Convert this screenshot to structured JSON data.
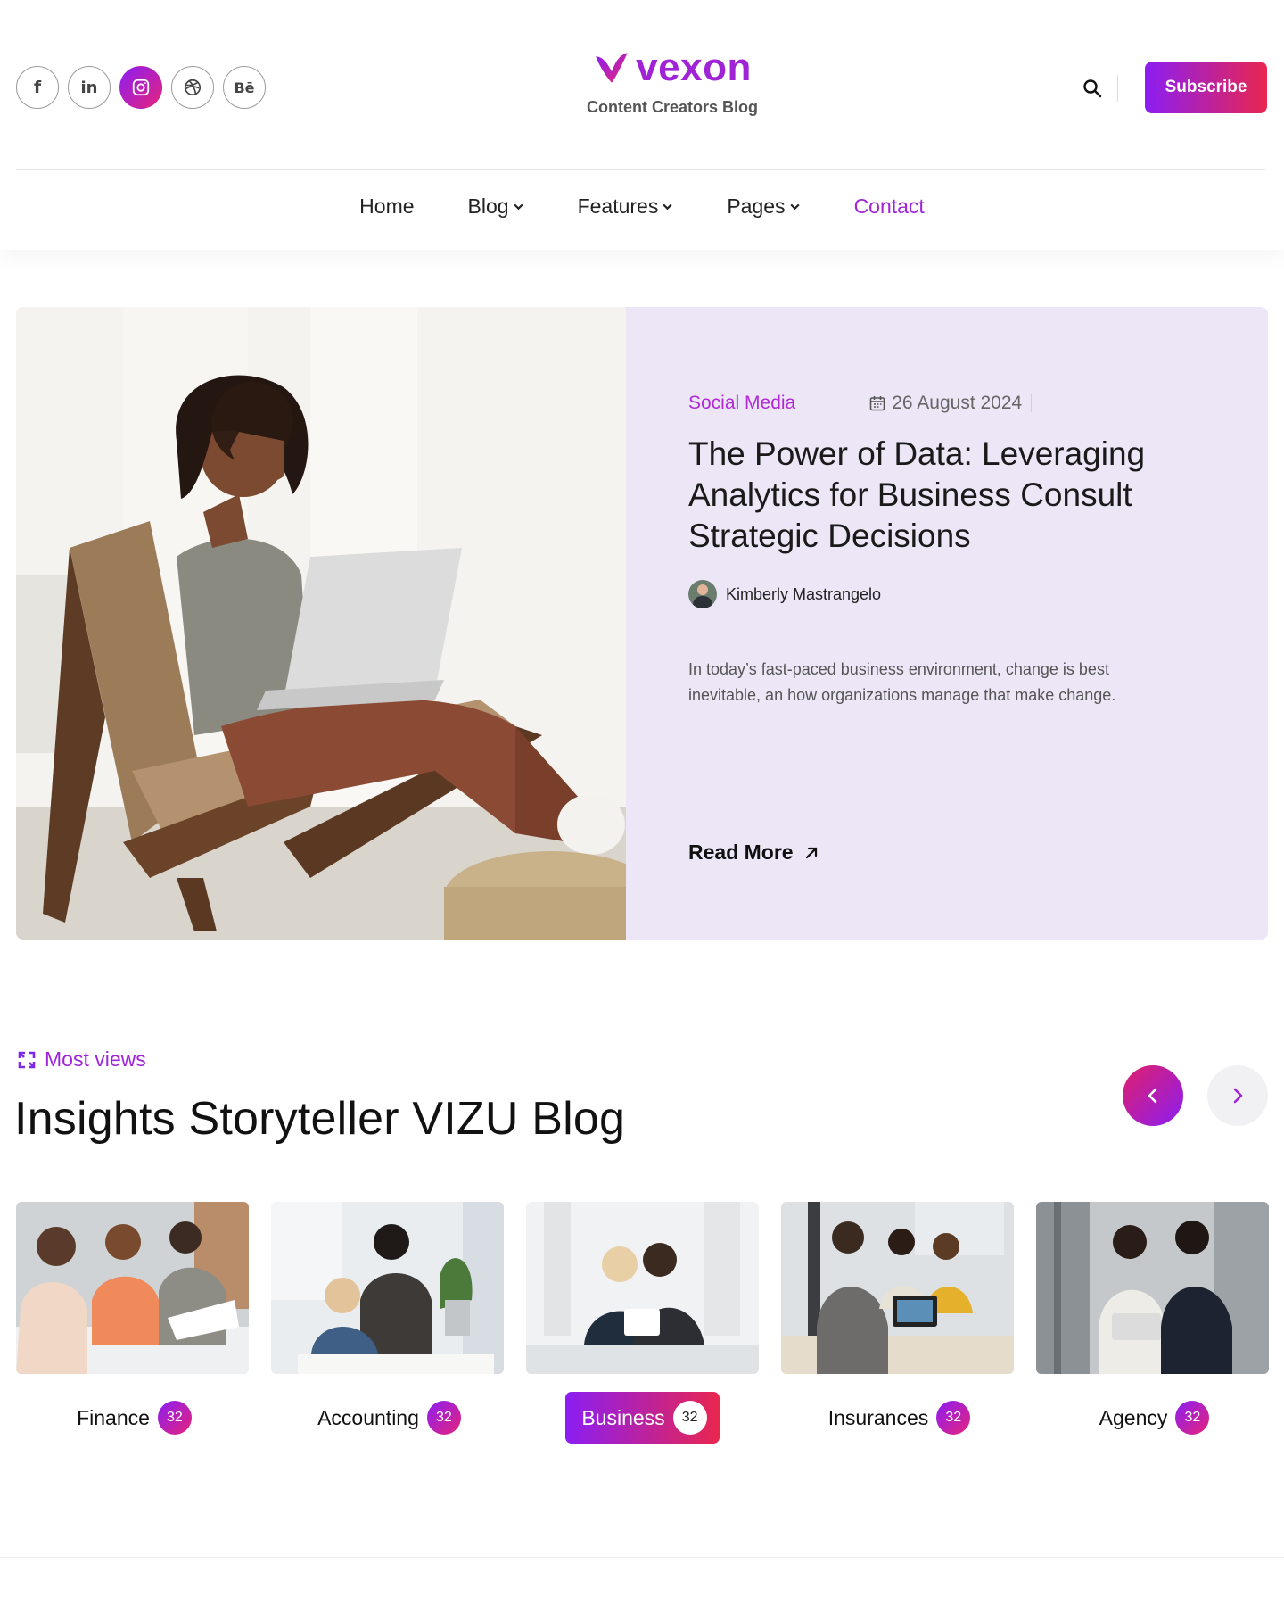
{
  "header": {
    "socials": [
      {
        "icon": "facebook-icon",
        "glyph": "f"
      },
      {
        "icon": "linkedin-icon",
        "glyph": "in"
      },
      {
        "icon": "instagram-icon",
        "glyph": ""
      },
      {
        "icon": "dribbble-icon",
        "glyph": ""
      },
      {
        "icon": "behance-icon",
        "glyph": "Bē"
      }
    ],
    "brand_name": "vexon",
    "brand_tagline": "Content Creators Blog",
    "subscribe_label": "Subscribe"
  },
  "nav": {
    "home": "Home",
    "blog": "Blog",
    "features": "Features",
    "pages": "Pages",
    "contact": "Contact"
  },
  "hero": {
    "category": "Social Media",
    "date": "26 August 2024",
    "title": "The Power of Data: Leveraging Analytics for Business Consult Strategic Decisions",
    "author": "Kimberly Mastrangelo",
    "excerpt": "In today’s fast-paced business environment, change is best inevitable, an how organizations manage that make change.",
    "read_more": "Read More"
  },
  "most_views": {
    "label": "Most views",
    "title": "Insights Storyteller VIZU Blog",
    "categories": [
      {
        "name": "Finance",
        "count": "32",
        "active": false
      },
      {
        "name": "Accounting",
        "count": "32",
        "active": false
      },
      {
        "name": "Business",
        "count": "32",
        "active": true
      },
      {
        "name": "Insurances",
        "count": "32",
        "active": false
      },
      {
        "name": "Agency",
        "count": "32",
        "active": false
      }
    ]
  },
  "colors": {
    "accent": "#a024d6",
    "gradient_start": "#8b1ef3",
    "gradient_end": "#e9264f",
    "hero_bg": "#ece6f6"
  }
}
